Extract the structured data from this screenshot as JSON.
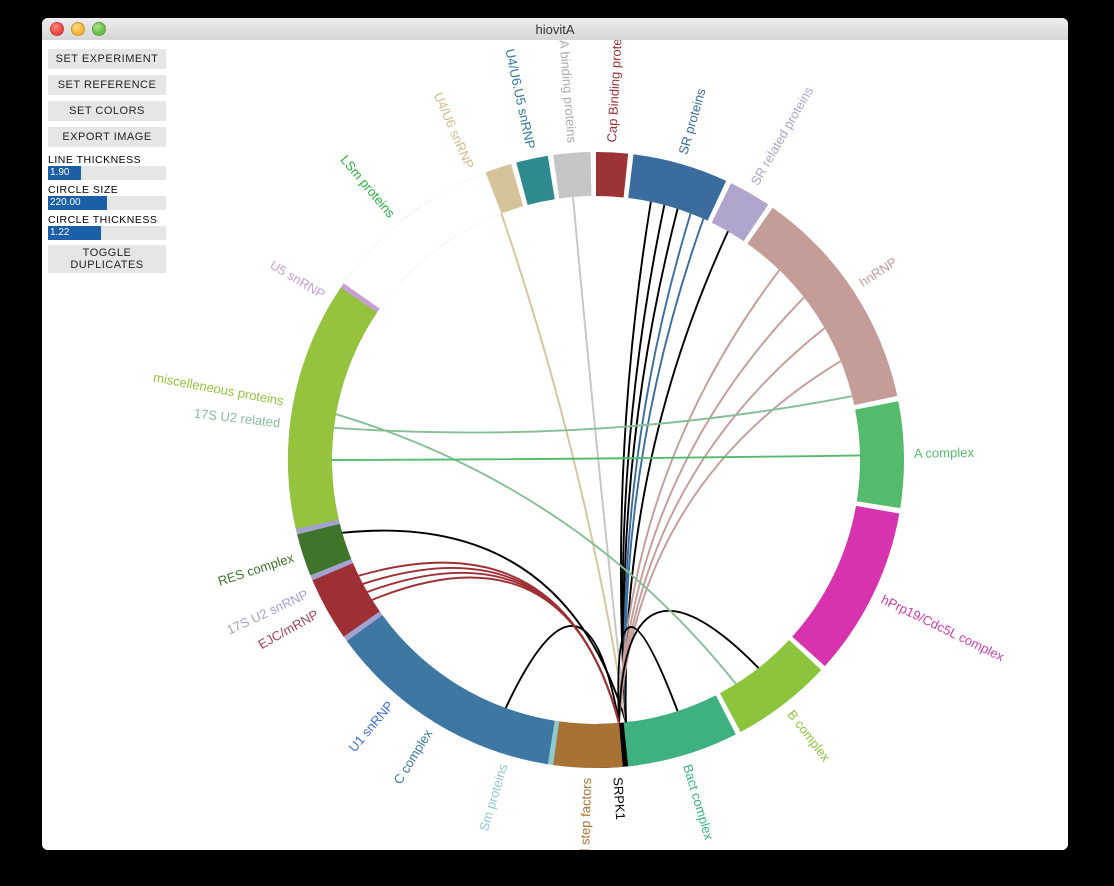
{
  "window": {
    "title": "hiovitA"
  },
  "sidebar": {
    "buttons": {
      "set_experiment": "SET EXPERIMENT",
      "set_reference": "SET REFERENCE",
      "set_colors": "SET COLORS",
      "export_image": "EXPORT IMAGE",
      "toggle_duplicates": "TOGGLE\nDUPLICATES"
    },
    "sliders": {
      "line_thickness": {
        "label": "LINE THICKNESS",
        "value": "1.90",
        "fillPct": 28
      },
      "circle_size": {
        "label": "CIRCLE SIZE",
        "value": "220.00",
        "fillPct": 50
      },
      "circle_thickness": {
        "label": "CIRCLE THICKNESS",
        "value": "1.22",
        "fillPct": 45
      }
    }
  },
  "chart_data": {
    "type": "chord",
    "center": [
      554,
      420
    ],
    "outer_radius": 308,
    "inner_radius": 264,
    "selected_segment": "SRPK1",
    "segments": [
      {
        "name": "SRPK1",
        "start": 172,
        "end": 180.5,
        "color": "#000000",
        "labelColor": "#000000"
      },
      {
        "name": "Sm proteins",
        "start": 181.5,
        "end": 212,
        "color": "#8fcacf",
        "labelColor": "#8fcacf"
      },
      {
        "name": "U1 snRNP",
        "start": 213,
        "end": 227,
        "color": "#3e6fd6",
        "labelColor": "#3e6fd6"
      },
      {
        "name": "17S U2 snRNP",
        "start": 228,
        "end": 262,
        "color": "#a3a2cf",
        "labelColor": "#a3a2cf"
      },
      {
        "name": "17S U2 related",
        "start": 263,
        "end": 290,
        "color": "#86bf96",
        "labelColor": "#86bf96"
      },
      {
        "name": "U5 snRNP",
        "start": 291,
        "end": 311,
        "color": "#c79fd1",
        "labelColor": "#c79fd1"
      },
      {
        "name": "LSm proteins",
        "start": 312,
        "end": 328,
        "color": "#25b43a",
        "labelColor": "#25b43a"
      },
      {
        "name": "U4/U6 snRNP",
        "start": 329,
        "end": 344,
        "color": "#d7c39a",
        "labelColor": "#d1bb8d"
      },
      {
        "name": "U4/U6.U5 snRNP",
        "start": 345,
        "end": 351,
        "color": "#2e8a8f",
        "labelColor": "#3477a5"
      },
      {
        "name": "RNA binding proteins",
        "start": 352,
        "end": 359,
        "color": "#c6c6c6",
        "labelColor": "#adadad"
      },
      {
        "name": "Cap Binding proteins",
        "start": 360,
        "end": 366,
        "color": "#9c3437",
        "labelColor": "#9c3437"
      },
      {
        "name": "SR proteins",
        "start": 367,
        "end": 385,
        "color": "#3b6c9e",
        "labelColor": "#3b6c9e"
      },
      {
        "name": "SR related proteins",
        "start": 386,
        "end": 394,
        "color": "#b1a4cd",
        "labelColor": "#b1a4cd"
      },
      {
        "name": "hnRNP",
        "start": 395,
        "end": 438,
        "color": "#c59d98",
        "labelColor": "#c59d98"
      },
      {
        "name": "A complex",
        "start": 439,
        "end": 459,
        "color": "#55bb6c",
        "labelColor": "#55bb6c"
      },
      {
        "name": "hPrp19/Cdc5L complex",
        "start": 460,
        "end": 492,
        "color": "#d733af",
        "labelColor": "#cf3fa9"
      },
      {
        "name": "B complex",
        "start": 493,
        "end": 512,
        "color": "#8cc53b",
        "labelColor": "#8cc53b"
      },
      {
        "name": "Bact complex",
        "start": 513,
        "end": 534,
        "color": "#3eb17e",
        "labelColor": "#3eb17e"
      },
      {
        "name": "Second step factors",
        "start": 535,
        "end": 548,
        "color": "#a97235",
        "labelColor": "#a97235"
      },
      {
        "name": "C complex",
        "start": 549,
        "end": 594,
        "color": "#3f77a3",
        "labelColor": "#3f77a3"
      },
      {
        "name": "EJC/mRNP",
        "start": 595,
        "end": 607,
        "color": "#9e2f34",
        "labelColor": "#a54461"
      },
      {
        "name": "RES complex",
        "start": 608,
        "end": 616,
        "color": "#3e752a",
        "labelColor": "#3e752a"
      },
      {
        "name": "miscelleneous proteins",
        "start": 617,
        "end": 664,
        "color": "#95c33e",
        "labelColor": "#95c33e"
      },
      {
        "name": "_gap",
        "start": 665,
        "end": 699,
        "color": "#ffffff",
        "labelColor": "#ffffff",
        "noLabel": true
      }
    ],
    "chords": [
      {
        "from": "SRPK1",
        "fromSide": "start",
        "to": "17S U2 snRNP",
        "toA": 254,
        "color": "#000000"
      },
      {
        "from": "SRPK1",
        "fromSide": "start",
        "to": "U4/U6 snRNP",
        "toA": 339,
        "color": "#d7c39a"
      },
      {
        "from": "SRPK1",
        "fromSide": "start",
        "to": "RNA binding proteins",
        "toA": 355,
        "color": "#c6c6c6"
      },
      {
        "from": "SRPK1",
        "fromSide": "start",
        "to": "SR proteins",
        "toA": 372,
        "color": "#000000"
      },
      {
        "from": "SRPK1",
        "fromSide": "start",
        "to": "SR proteins",
        "toA": 375,
        "color": "#000000"
      },
      {
        "from": "SRPK1",
        "fromSide": "start",
        "to": "SR proteins",
        "toA": 378,
        "color": "#000000"
      },
      {
        "from": "SRPK1",
        "fromSide": "start",
        "to": "SR proteins",
        "toA": 381,
        "color": "#3b6c9e"
      },
      {
        "from": "SRPK1",
        "fromSide": "start",
        "to": "SR proteins",
        "toA": 384,
        "color": "#3b6c9e"
      },
      {
        "from": "SRPK1",
        "fromSide": "start",
        "to": "SR related proteins",
        "toA": 390,
        "color": "#000000"
      },
      {
        "from": "SRPK1",
        "fromSide": "end",
        "to": "hnRNP",
        "toA": 404,
        "color": "#c59d98"
      },
      {
        "from": "SRPK1",
        "fromSide": "end",
        "to": "hnRNP",
        "toA": 412,
        "color": "#c59d98"
      },
      {
        "from": "SRPK1",
        "fromSide": "end",
        "to": "hnRNP",
        "toA": 420,
        "color": "#c59d98"
      },
      {
        "from": "SRPK1",
        "fromSide": "end",
        "to": "hnRNP",
        "toA": 428,
        "color": "#c59d98"
      },
      {
        "from": "SRPK1",
        "fromSide": "end",
        "to": "B complex",
        "toA": 502,
        "color": "#000000"
      },
      {
        "from": "SRPK1",
        "fromSide": "end",
        "to": "Bact complex",
        "toA": 522,
        "color": "#000000"
      },
      {
        "from": "SRPK1",
        "fromSide": "end",
        "to": "C complex",
        "toA": 560,
        "color": "#000000"
      },
      {
        "from": "SRPK1",
        "fromSide": "end",
        "to": "EJC/mRNP",
        "toA": 598,
        "color": "#9e2f34"
      },
      {
        "from": "SRPK1",
        "fromSide": "end",
        "to": "EJC/mRNP",
        "toA": 600,
        "color": "#9e2f34"
      },
      {
        "from": "SRPK1",
        "fromSide": "end",
        "to": "EJC/mRNP",
        "toA": 602,
        "color": "#9e2f34"
      },
      {
        "from": "SRPK1",
        "fromSide": "end",
        "to": "EJC/mRNP",
        "toA": 604,
        "color": "#9e2f34"
      },
      {
        "from": "17S U2 related",
        "fromA": 277,
        "to": "hnRNP",
        "toA": 436,
        "color": "#86bf96"
      },
      {
        "from": "17S U2 related",
        "fromA": 280,
        "to": "B complex",
        "toA": 508,
        "color": "#86bf96"
      },
      {
        "from": "miscelleneous proteins",
        "fromA": 630,
        "to": "A complex",
        "toA": 449,
        "color": "#55bb6c"
      }
    ]
  }
}
